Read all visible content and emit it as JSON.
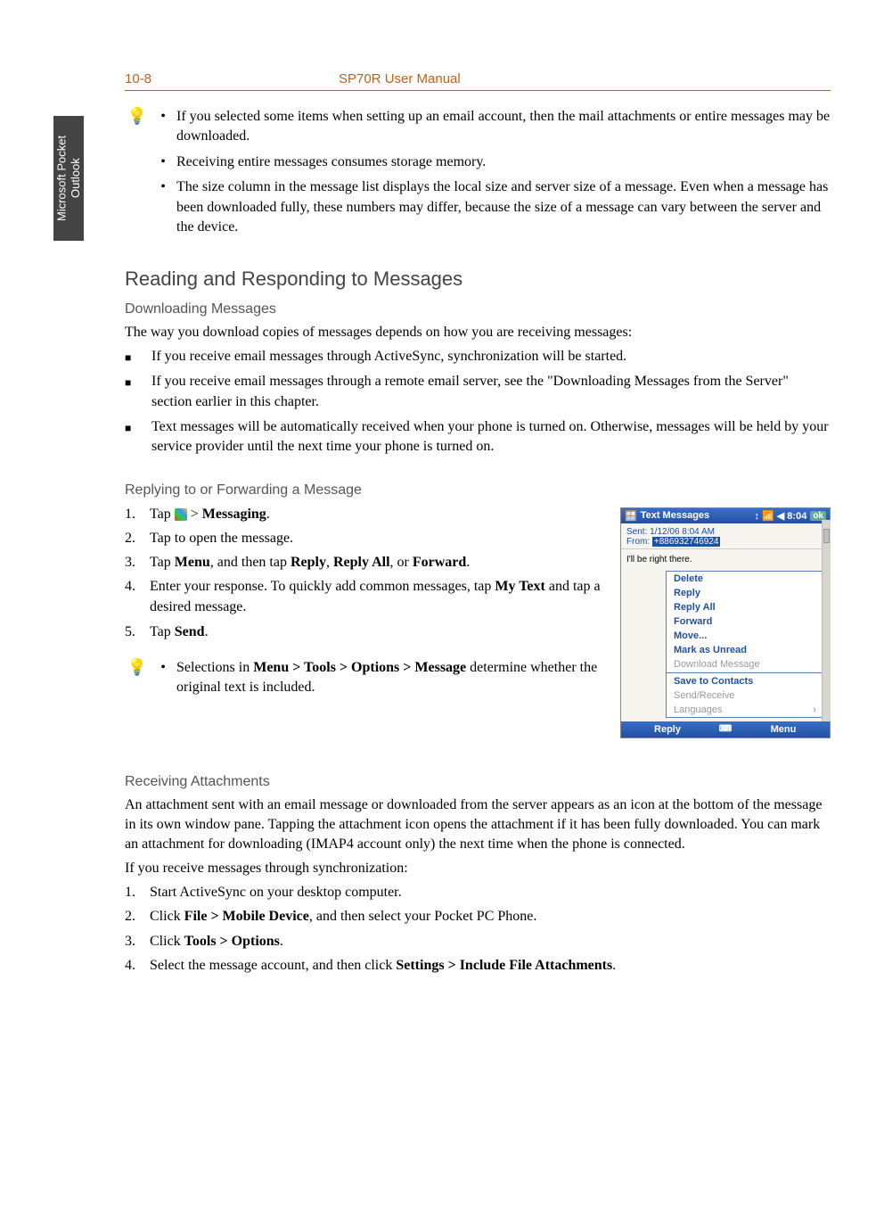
{
  "header": {
    "page_num": "10-8",
    "title": "SP70R User Manual"
  },
  "side_tab": "Microsoft Pocket Outlook",
  "tip1": {
    "items": [
      "If you selected some items when setting up an email account, then the mail attachments or entire messages may be downloaded.",
      "Receiving entire messages consumes storage memory.",
      "The size column in the message list displays the local size and server size of a message. Even when a message has been downloaded fully, these numbers may differ, because the size of a message can vary between the server and the device."
    ]
  },
  "section1": {
    "heading": "Reading and Responding to Messages",
    "sub_heading": "Downloading Messages",
    "intro": "The way you download copies of messages depends on how you are receiving messages:",
    "bullets": [
      "If you receive email messages through ActiveSync, synchronization will be started.",
      "If you receive email messages through a remote email server, see the \"Downloading Messages from the Server\" section earlier in this chapter.",
      "Text messages will be automatically received when your phone is turned on. Otherwise, messages will be held by your service provider until the next time your phone is turned on."
    ]
  },
  "section2": {
    "heading": "Replying to or Forwarding a Message",
    "steps": {
      "s1_pre": "Tap ",
      "s1_post": " > ",
      "s1_bold": "Messaging",
      "s1_end": ".",
      "s2": "Tap to open the message.",
      "s3_pre": "Tap ",
      "s3_b1": "Menu",
      "s3_mid1": ", and then tap ",
      "s3_b2": "Reply",
      "s3_mid2": ", ",
      "s3_b3": "Reply All",
      "s3_mid3": ", or ",
      "s3_b4": "Forward",
      "s3_end": ".",
      "s4_pre": "Enter your response. To quickly add common messages, tap ",
      "s4_b1": "My Text",
      "s4_post": " and tap a desired message.",
      "s5_pre": "Tap ",
      "s5_b": "Send",
      "s5_end": "."
    },
    "tip_pre": "Selections in ",
    "tip_b": "Menu > Tools > Options > Message",
    "tip_post": " determine whether the original text is included."
  },
  "screenshot": {
    "title": "Text Messages",
    "status_icons": "↕  📶 ◀ 8:04",
    "ok": "ok",
    "sent_label": "Sent:",
    "sent_val": "1/12/06 8:04 AM",
    "from_label": "From:",
    "from_val": "+886932746924",
    "body": "I'll be right there.",
    "menu": {
      "delete": "Delete",
      "reply": "Reply",
      "reply_all": "Reply All",
      "forward": "Forward",
      "move": "Move...",
      "mark_unread": "Mark as Unread",
      "download": "Download Message",
      "save_contacts": "Save to Contacts",
      "send_receive": "Send/Receive",
      "languages": "Languages"
    },
    "soft_left": "Reply",
    "soft_mid": "⌨",
    "soft_right": "Menu"
  },
  "section3": {
    "heading": "Receiving Attachments",
    "p1": "An attachment sent with an email message or downloaded from the server appears as an icon at the bottom of the message in its own window pane. Tapping the attachment icon opens the attachment if it has been fully downloaded. You can mark an attachment for downloading (IMAP4 account only) the next time when the phone is connected.",
    "p2": "If you receive messages through synchronization:",
    "steps": {
      "s1": "Start ActiveSync on your desktop computer.",
      "s2_pre": "Click ",
      "s2_b": "File > Mobile Device",
      "s2_post": ", and then select your Pocket PC Phone.",
      "s3_pre": "Click ",
      "s3_b": "Tools > Options",
      "s3_post": ".",
      "s4_pre": "Select the message account, and then click ",
      "s4_b": "Settings > Include File Attachments",
      "s4_post": "."
    }
  }
}
